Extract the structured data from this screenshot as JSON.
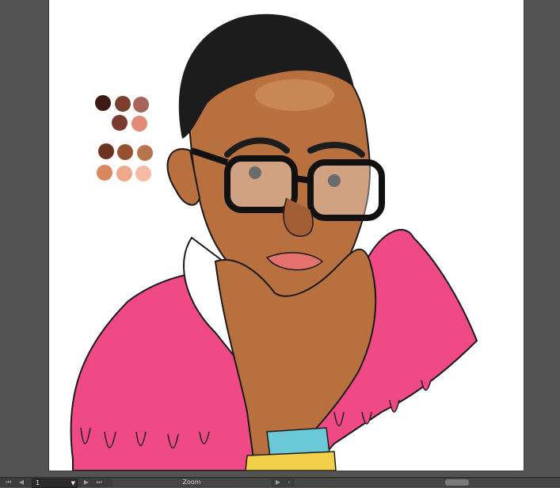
{
  "artwork": {
    "palette_colors": [
      "#3d1a14",
      "#7d3e30",
      "#a8645a",
      "#7a3a2e",
      "#e08b78",
      "#6b3220",
      "#94502f",
      "#b8744a",
      "#d8875e",
      "#f0a88c",
      "#f7bba4"
    ],
    "colors": {
      "shirt": "#f04a86",
      "skin": "#b8703f",
      "skin_light": "#d49665",
      "hair": "#1c1c1c",
      "lips": "#e5716c",
      "wristband": "#6bc8d6",
      "bracelet": "#f2d04a"
    }
  },
  "statusbar": {
    "first_page_icon": "first-page-icon",
    "prev_page_icon": "prev-page-icon",
    "page_number": "1",
    "next_page_icon": "next-page-icon",
    "last_page_icon": "last-page-icon",
    "zoom_label": "Zoom",
    "play_icon": "play-icon",
    "scroll_left_icon": "scroll-left-icon"
  }
}
